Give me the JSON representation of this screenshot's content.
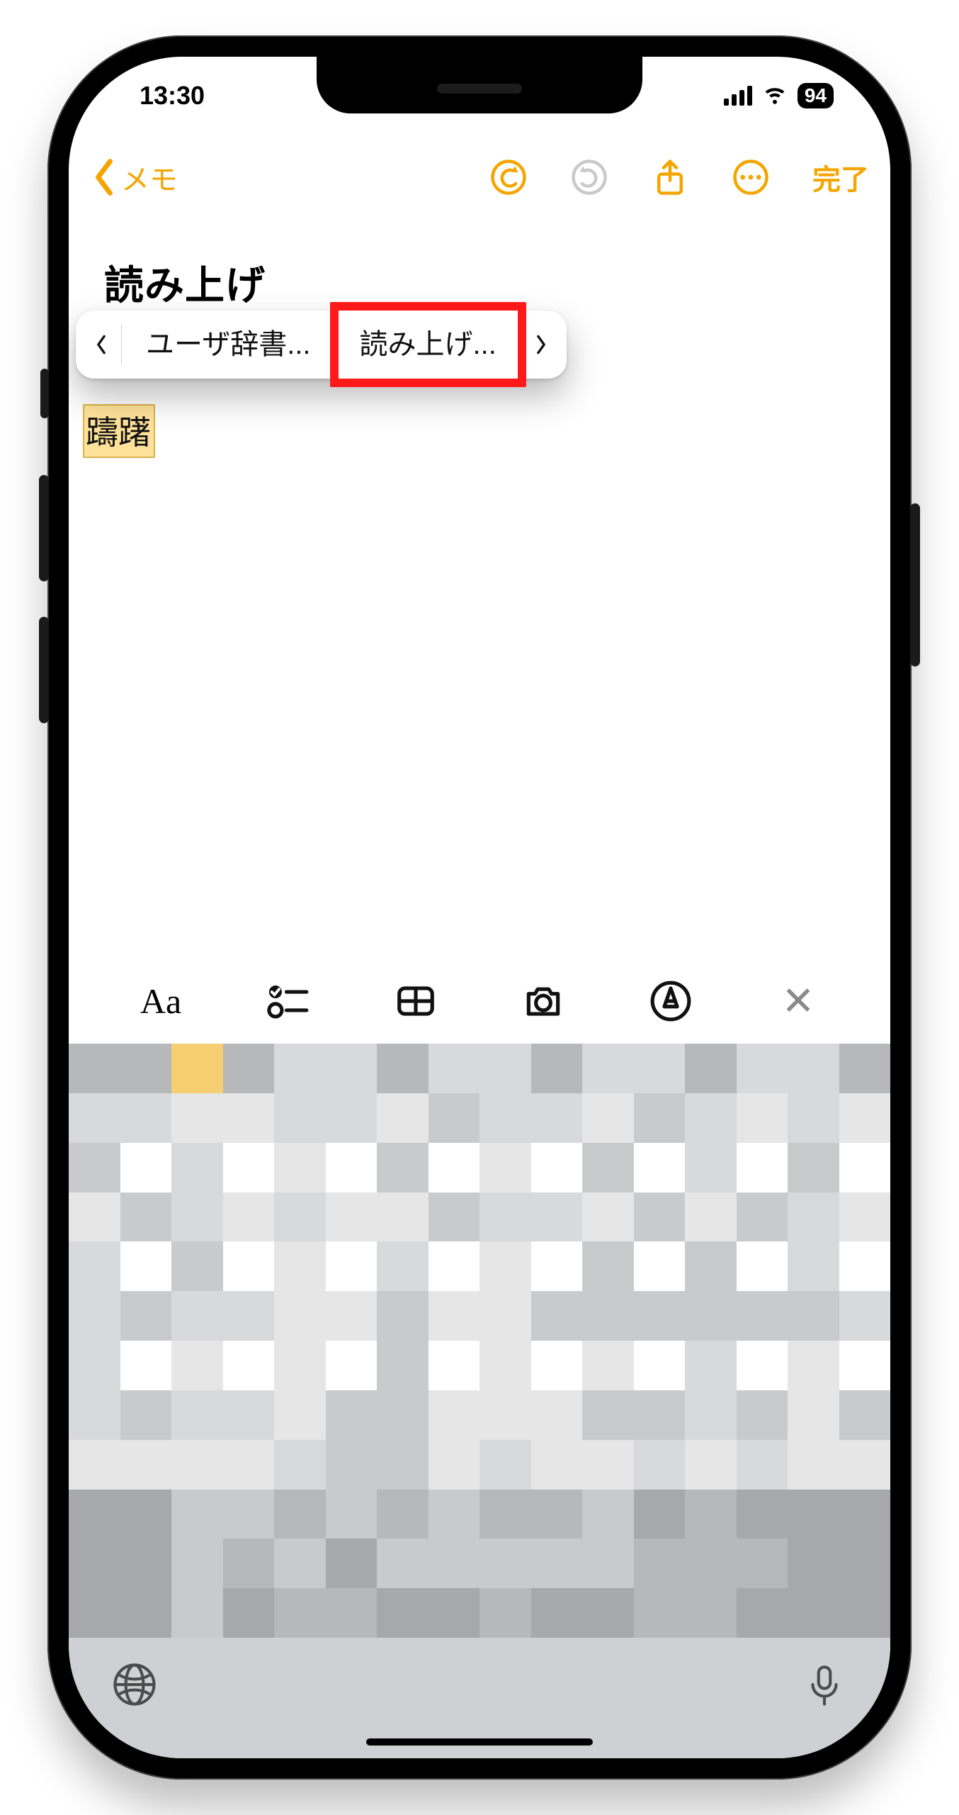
{
  "status": {
    "time": "13:30",
    "battery": "94"
  },
  "nav": {
    "back_label": "メモ",
    "done_label": "完了"
  },
  "note": {
    "title": "読み上げ",
    "selected_text": "躊躇"
  },
  "popup": {
    "items": [
      "ユーザ辞書...",
      "読み上げ..."
    ],
    "highlight_index": 1
  },
  "format_bar": {
    "text_format": "Aa"
  }
}
